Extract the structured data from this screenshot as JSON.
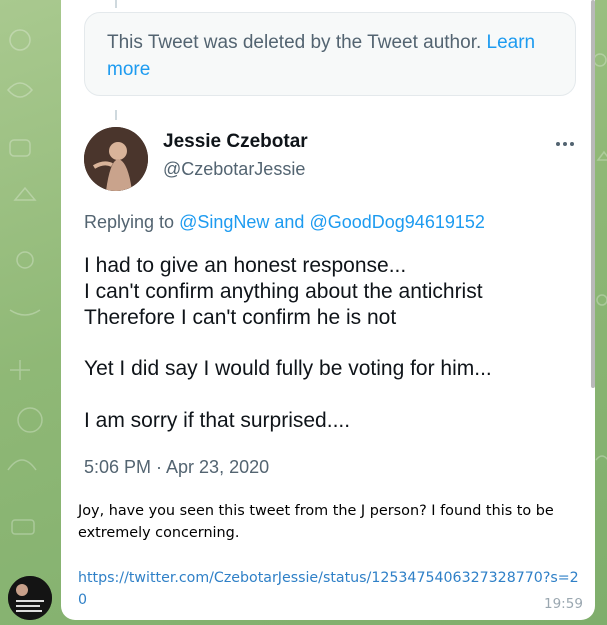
{
  "deleted_notice": {
    "text": "This Tweet was deleted by the Tweet author.",
    "link": "Learn more"
  },
  "tweet": {
    "author_name": "Jessie Czebotar",
    "author_handle": "@CzebotarJessie",
    "reply_prefix": "Replying to",
    "reply_mention_1": "@SingNew",
    "reply_and": "and",
    "reply_mention_2": "@GoodDog94619152",
    "lines": [
      "I had to give an honest response...",
      "I can't confirm anything about the antichrist",
      "Therefore I can't confirm he is not",
      "Yet I did say I would fully be voting for him...",
      "I am sorry if that surprised...."
    ],
    "timestamp": "5:06 PM · Apr 23, 2020",
    "more_icon": "more-dots-icon"
  },
  "message": {
    "text": "Joy, have you seen this tweet from the J person? I found this to be extremely concerning.",
    "link": "https://twitter.com/CzebotarJessie/status/1253475406327328770?s=20",
    "time": "19:59"
  }
}
